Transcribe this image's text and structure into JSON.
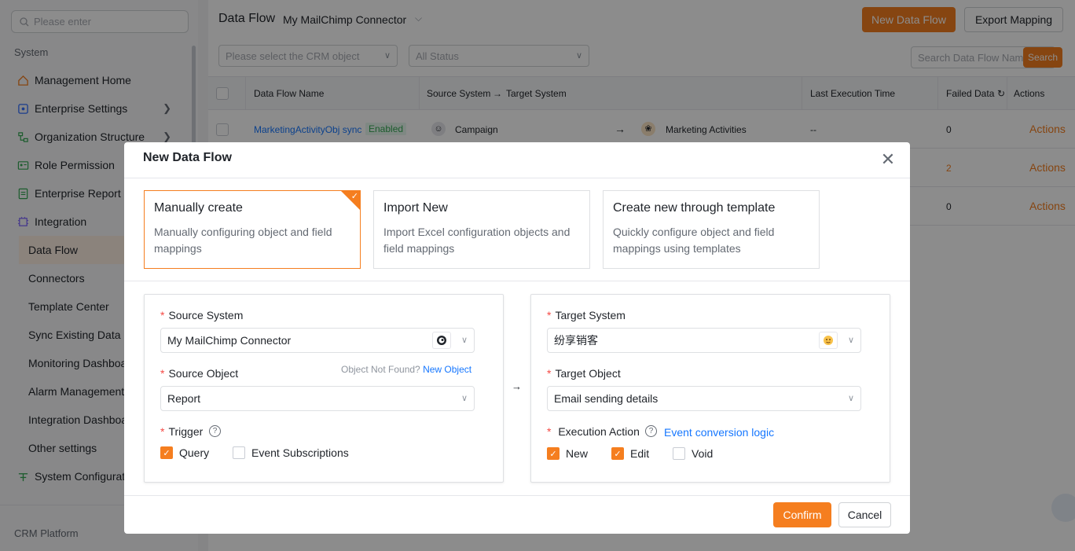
{
  "sidebar": {
    "search_placeholder": "Please enter",
    "section_system": "System",
    "items": [
      {
        "label": "Management Home"
      },
      {
        "label": "Enterprise Settings"
      },
      {
        "label": "Organization Structure"
      },
      {
        "label": "Role Permission"
      },
      {
        "label": "Enterprise Report"
      },
      {
        "label": "Integration"
      }
    ],
    "sub_items": [
      {
        "label": "Data Flow"
      },
      {
        "label": "Connectors"
      },
      {
        "label": "Template Center"
      },
      {
        "label": "Sync Existing Data"
      },
      {
        "label": "Monitoring Dashboard"
      },
      {
        "label": "Alarm Management"
      },
      {
        "label": "Integration Dashboard"
      },
      {
        "label": "Other settings"
      }
    ],
    "system_config": "System Configuration",
    "section_crm": "CRM Platform"
  },
  "header": {
    "title": "Data Flow",
    "connector": "My MailChimp Connector",
    "new_flow_button": "New Data Flow",
    "export_button": "Export Mapping"
  },
  "filters": {
    "crm_object_placeholder": "Please select the CRM object",
    "status_placeholder": "All Status",
    "search_placeholder": "Search Data Flow Name",
    "search_button": "Search"
  },
  "table": {
    "columns": {
      "name": "Data Flow Name",
      "source_target": "Source System",
      "target": "Target System",
      "last_exec": "Last Execution Time",
      "failed": "Failed Data",
      "actions": "Actions"
    },
    "rows": [
      {
        "name": "MarketingActivityObj sync",
        "status": "Enabled",
        "source": "Campaign",
        "target": "Marketing Activities",
        "last_exec": "--",
        "failed": "0",
        "action": "Actions"
      },
      {
        "failed": "2",
        "action": "Actions"
      },
      {
        "failed": "0",
        "action": "Actions"
      }
    ]
  },
  "modal": {
    "title": "New Data Flow",
    "options": [
      {
        "title": "Manually create",
        "desc": "Manually configuring object and field mappings"
      },
      {
        "title": "Import New",
        "desc": "Import Excel configuration objects and field mappings"
      },
      {
        "title": "Create new through template",
        "desc": "Quickly configure object and field mappings using templates"
      }
    ],
    "source": {
      "system_label": "Source System",
      "system_value": "My MailChimp Connector",
      "object_label": "Source Object",
      "object_not_found": "Object Not Found?",
      "new_object": "New Object",
      "object_value": "Report",
      "trigger_label": "Trigger",
      "trigger_query": "Query",
      "trigger_event": "Event Subscriptions"
    },
    "target": {
      "system_label": "Target System",
      "system_value": "纷享销客",
      "object_label": "Target Object",
      "object_value": "Email sending details",
      "action_label": "Execution Action",
      "conversion_link": "Event conversion logic",
      "action_new": "New",
      "action_edit": "Edit",
      "action_void": "Void"
    },
    "confirm": "Confirm",
    "cancel": "Cancel"
  },
  "colors": {
    "accent": "#f57e1f",
    "link": "#1677ff",
    "required": "#f54a45"
  }
}
